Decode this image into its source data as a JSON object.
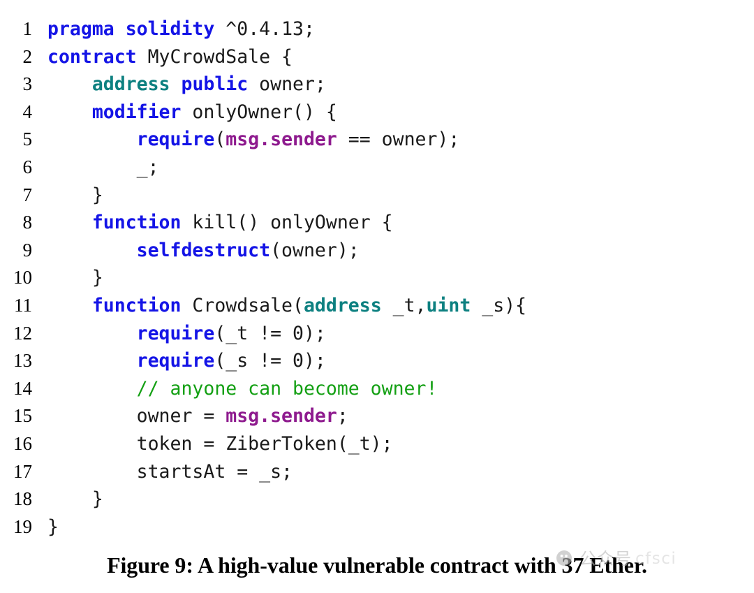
{
  "figure": {
    "caption": "Figure 9: A high-value vulnerable contract with 37 Ether.",
    "language": "solidity"
  },
  "code": {
    "lines": [
      {
        "n": "1",
        "tokens": [
          {
            "t": "pragma",
            "c": "kw"
          },
          {
            "t": " ",
            "c": "plain"
          },
          {
            "t": "solidity",
            "c": "kw"
          },
          {
            "t": " ^0.4.13;",
            "c": "plain"
          }
        ]
      },
      {
        "n": "2",
        "tokens": [
          {
            "t": "contract",
            "c": "kw"
          },
          {
            "t": " MyCrowdSale {",
            "c": "plain"
          }
        ]
      },
      {
        "n": "3",
        "tokens": [
          {
            "t": "    ",
            "c": "plain"
          },
          {
            "t": "address",
            "c": "type"
          },
          {
            "t": " ",
            "c": "plain"
          },
          {
            "t": "public",
            "c": "kw"
          },
          {
            "t": " owner;",
            "c": "plain"
          }
        ]
      },
      {
        "n": "4",
        "tokens": [
          {
            "t": "    ",
            "c": "plain"
          },
          {
            "t": "modifier",
            "c": "kw"
          },
          {
            "t": " onlyOwner() {",
            "c": "plain"
          }
        ]
      },
      {
        "n": "5",
        "tokens": [
          {
            "t": "        ",
            "c": "plain"
          },
          {
            "t": "require",
            "c": "builtin"
          },
          {
            "t": "(",
            "c": "plain"
          },
          {
            "t": "msg.sender",
            "c": "magic"
          },
          {
            "t": " == owner);",
            "c": "plain"
          }
        ]
      },
      {
        "n": "6",
        "tokens": [
          {
            "t": "        _;",
            "c": "plain"
          }
        ]
      },
      {
        "n": "7",
        "tokens": [
          {
            "t": "    }",
            "c": "plain"
          }
        ]
      },
      {
        "n": "8",
        "tokens": [
          {
            "t": "    ",
            "c": "plain"
          },
          {
            "t": "function",
            "c": "kw"
          },
          {
            "t": " kill() onlyOwner {",
            "c": "plain"
          }
        ]
      },
      {
        "n": "9",
        "tokens": [
          {
            "t": "        ",
            "c": "plain"
          },
          {
            "t": "selfdestruct",
            "c": "builtin"
          },
          {
            "t": "(owner);",
            "c": "plain"
          }
        ]
      },
      {
        "n": "10",
        "tokens": [
          {
            "t": "    }",
            "c": "plain"
          }
        ]
      },
      {
        "n": "11",
        "tokens": [
          {
            "t": "    ",
            "c": "plain"
          },
          {
            "t": "function",
            "c": "kw"
          },
          {
            "t": " Crowdsale(",
            "c": "plain"
          },
          {
            "t": "address",
            "c": "type"
          },
          {
            "t": " _t,",
            "c": "plain"
          },
          {
            "t": "uint",
            "c": "type"
          },
          {
            "t": " _s){",
            "c": "plain"
          }
        ]
      },
      {
        "n": "12",
        "tokens": [
          {
            "t": "        ",
            "c": "plain"
          },
          {
            "t": "require",
            "c": "builtin"
          },
          {
            "t": "(_t != 0);",
            "c": "plain"
          }
        ]
      },
      {
        "n": "13",
        "tokens": [
          {
            "t": "        ",
            "c": "plain"
          },
          {
            "t": "require",
            "c": "builtin"
          },
          {
            "t": "(_s != 0);",
            "c": "plain"
          }
        ]
      },
      {
        "n": "14",
        "tokens": [
          {
            "t": "        ",
            "c": "plain"
          },
          {
            "t": "// anyone can become owner!",
            "c": "comment"
          }
        ]
      },
      {
        "n": "15",
        "tokens": [
          {
            "t": "        owner = ",
            "c": "plain"
          },
          {
            "t": "msg.sender",
            "c": "magic"
          },
          {
            "t": ";",
            "c": "plain"
          }
        ]
      },
      {
        "n": "16",
        "tokens": [
          {
            "t": "        token = ZiberToken(_t);",
            "c": "plain"
          }
        ]
      },
      {
        "n": "17",
        "tokens": [
          {
            "t": "        startsAt = _s;",
            "c": "plain"
          }
        ]
      },
      {
        "n": "18",
        "tokens": [
          {
            "t": "    }",
            "c": "plain"
          }
        ]
      },
      {
        "n": "19",
        "tokens": [
          {
            "t": "}",
            "c": "plain"
          }
        ]
      }
    ]
  },
  "watermark": {
    "logo_icon": "wechat-chat-bubble-icon",
    "chinese_text": "公众号",
    "latin_text": "cfsci"
  },
  "colors": {
    "keyword": "#1414e6",
    "type": "#0d8080",
    "builtin": "#1414e6",
    "magic_variable": "#8e1a8e",
    "comment": "#14a014",
    "plain_text": "#1a1a1a",
    "background": "#ffffff",
    "caption_text": "#000000",
    "watermark_gray": "#b9b9b9"
  }
}
